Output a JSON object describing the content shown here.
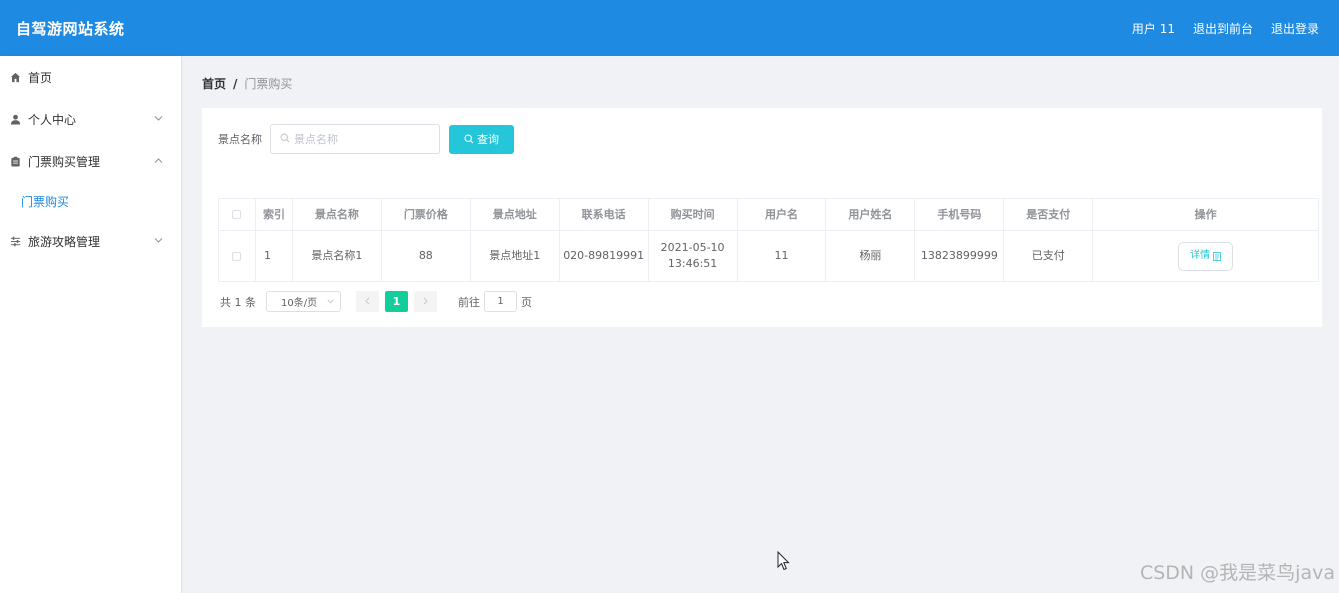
{
  "header": {
    "title": "自驾游网站系统",
    "user": "用户 11",
    "front_link": "退出到前台",
    "logout": "退出登录"
  },
  "sidebar": {
    "items": [
      {
        "label": "首页",
        "icon": "home-icon"
      },
      {
        "label": "个人中心",
        "icon": "user-icon"
      },
      {
        "label": "门票购买管理",
        "icon": "clipboard-icon",
        "expanded": true,
        "children": [
          {
            "label": "门票购买"
          }
        ]
      },
      {
        "label": "旅游攻略管理",
        "icon": "sliders-icon"
      }
    ]
  },
  "breadcrumb": {
    "home": "首页",
    "sep": "/",
    "current": "门票购买"
  },
  "search": {
    "label": "景点名称",
    "placeholder": "景点名称",
    "value": "",
    "button": "查询"
  },
  "table": {
    "headers": [
      "索引",
      "景点名称",
      "门票价格",
      "景点地址",
      "联系电话",
      "购买时间",
      "用户名",
      "用户姓名",
      "手机号码",
      "是否支付",
      "操作"
    ],
    "rows": [
      {
        "index": "1",
        "name": "景点名称1",
        "price": "88",
        "address": "景点地址1",
        "phone": "020-89819991",
        "time": "2021-05-10 13:46:51",
        "username": "11",
        "realname": "杨丽",
        "mobile": "13823899999",
        "paid": "已支付",
        "action": "详情"
      }
    ]
  },
  "pagination": {
    "total": "共 1 条",
    "size": "10条/页",
    "page": "1",
    "goto": "前往",
    "goto_value": "1",
    "page_unit": "页"
  },
  "watermark": "CSDN @我是菜鸟java",
  "colors": {
    "header_bg": "#1f8ae2",
    "search_btn": "#25c6da",
    "active_page": "#13ce9b"
  }
}
